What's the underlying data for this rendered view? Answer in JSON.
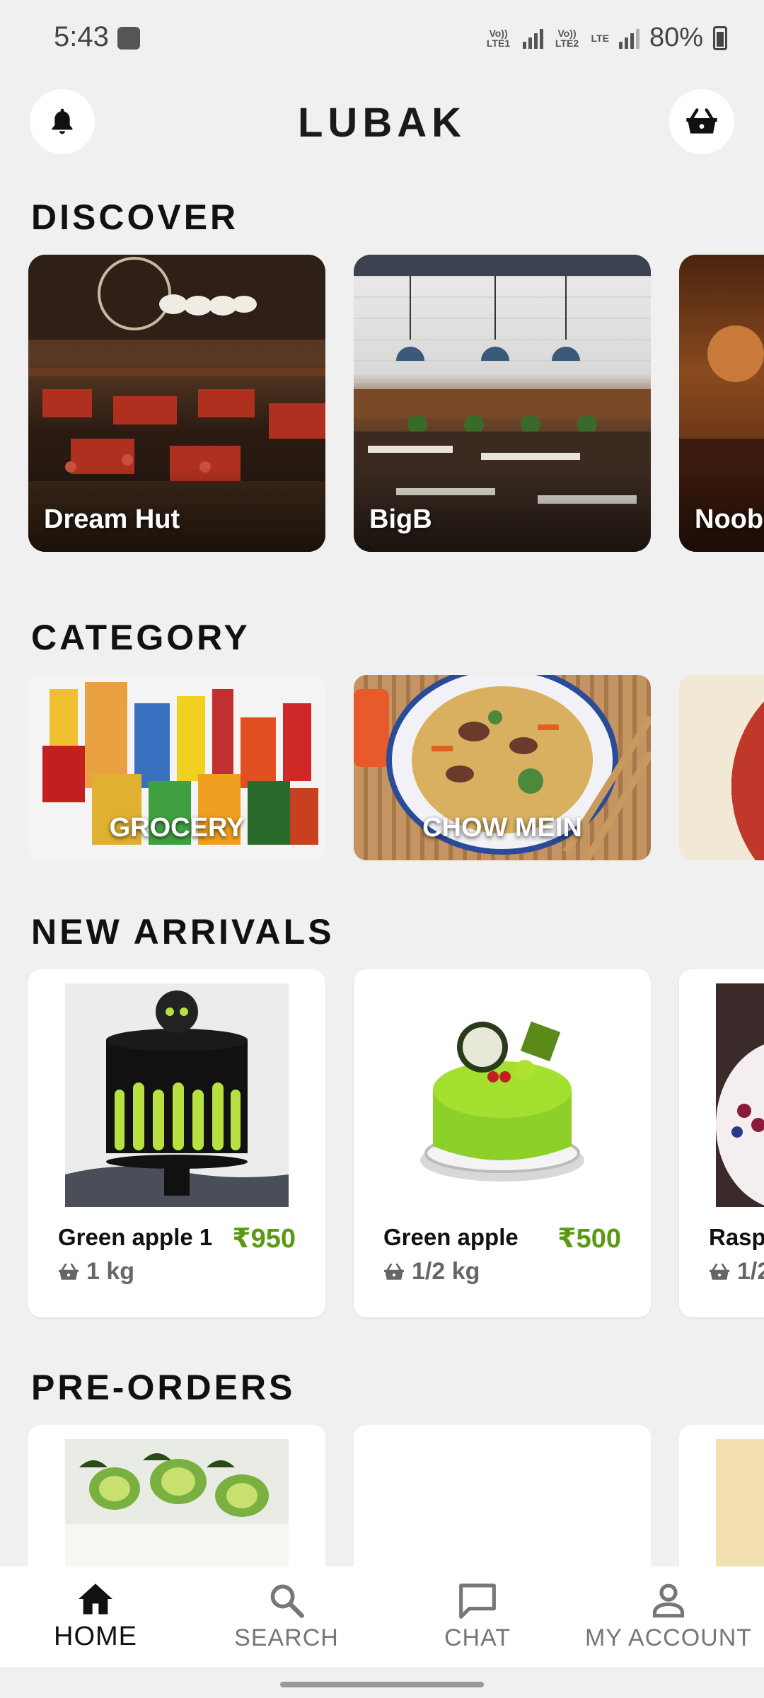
{
  "status_bar": {
    "time": "5:43",
    "sim1_label": "Vo)) LTE1",
    "sim2_label": "Vo)) LTE2",
    "lte_label": "LTE",
    "battery_percent": "80%"
  },
  "header": {
    "title": "LUBAK",
    "left_icon": "bell-icon",
    "right_icon": "basket-icon"
  },
  "discover": {
    "title": "DISCOVER",
    "items": [
      {
        "name": "Dream Hut"
      },
      {
        "name": "BigB"
      },
      {
        "name": "Noob"
      }
    ]
  },
  "category": {
    "title": "CATEGORY",
    "items": [
      {
        "name": "GROCERY"
      },
      {
        "name": "CHOW MEIN"
      },
      {
        "name": ""
      }
    ]
  },
  "new_arrivals": {
    "title": "NEW ARRIVALS",
    "items": [
      {
        "name": "Green apple 1",
        "price": "₹950",
        "qty": "1 kg"
      },
      {
        "name": "Green apple",
        "price": "₹500",
        "qty": "1/2 kg"
      },
      {
        "name": "Rasp",
        "price": "",
        "qty": "1/2"
      }
    ]
  },
  "pre_orders": {
    "title": "PRE-ORDERS"
  },
  "bottom_nav": {
    "items": [
      {
        "label": "HOME",
        "icon": "home-icon",
        "active": true
      },
      {
        "label": "SEARCH",
        "icon": "search-icon",
        "active": false
      },
      {
        "label": "CHAT",
        "icon": "chat-icon",
        "active": false
      },
      {
        "label": "MY ACCOUNT",
        "icon": "account-icon",
        "active": false
      }
    ]
  },
  "colors": {
    "background": "#f0f0f0",
    "price_green": "#5a9a12",
    "nav_active": "#111111",
    "nav_inactive": "#777777"
  }
}
